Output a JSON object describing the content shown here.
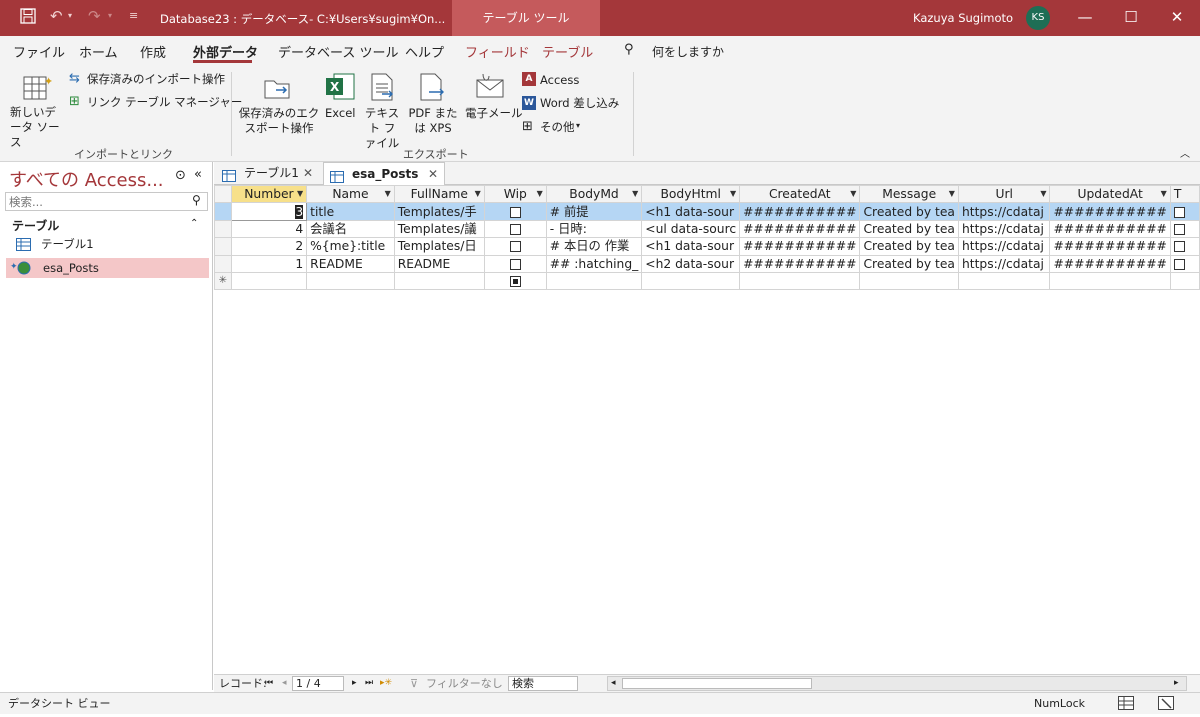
{
  "titlebar": {
    "doc_title": "Database23 : データベース- C:¥Users¥sugim¥On...",
    "tool_tab": "テーブル ツール",
    "user_name": "Kazuya Sugimoto",
    "user_initials": "KS"
  },
  "ribbon_tabs": [
    "ファイル",
    "ホーム",
    "作成",
    "外部データ",
    "データベース ツール",
    "ヘルプ",
    "フィールド",
    "テーブル"
  ],
  "tell_me": "何をしますか",
  "ribbon": {
    "new_source": "新しいデータ ソース",
    "saved_import": "保存済みのインポート操作",
    "linked_table_mgr": "リンク テーブル マネージャー",
    "group_import": "インポートとリンク",
    "saved_export": "保存済みのエクスポート操作",
    "excel": "Excel",
    "text_file": "テキスト ファイル",
    "pdf_xps": "PDF または XPS",
    "email": "電子メール",
    "access": "Access",
    "word_merge": "Word 差し込み",
    "more": "その他",
    "group_export": "エクスポート"
  },
  "nav": {
    "title": "すべての Access...",
    "search_placeholder": "検索...",
    "section": "テーブル",
    "items": [
      "テーブル1",
      "esa_Posts"
    ]
  },
  "doc_tabs": [
    "テーブル1",
    "esa_Posts"
  ],
  "table": {
    "columns": [
      "Number",
      "Name",
      "FullName",
      "Wip",
      "BodyMd",
      "BodyHtml",
      "CreatedAt",
      "Message",
      "Url",
      "UpdatedAt",
      "T"
    ],
    "rows": [
      {
        "Number": "3",
        "Name": "title",
        "FullName": "Templates/手",
        "Wip": false,
        "BodyMd": "# 前提",
        "BodyHtml": "<h1 data-sour",
        "CreatedAt": "###########",
        "Message": "Created by tea",
        "Url": "https://cdataj",
        "UpdatedAt": "###########"
      },
      {
        "Number": "4",
        "Name": "会議名",
        "FullName": "Templates/議",
        "Wip": false,
        "BodyMd": "- 日時:",
        "BodyHtml": "<ul data-sourc",
        "CreatedAt": "###########",
        "Message": "Created by tea",
        "Url": "https://cdataj",
        "UpdatedAt": "###########"
      },
      {
        "Number": "2",
        "Name": "%{me}:title",
        "FullName": "Templates/日",
        "Wip": false,
        "BodyMd": "# 本日の 作業",
        "BodyHtml": "<h1 data-sour",
        "CreatedAt": "###########",
        "Message": "Created by tea",
        "Url": "https://cdataj",
        "UpdatedAt": "###########"
      },
      {
        "Number": "1",
        "Name": "README",
        "FullName": "README",
        "Wip": false,
        "BodyMd": "##  :hatching_",
        "BodyHtml": "<h2 data-sour",
        "CreatedAt": "###########",
        "Message": "Created by tea",
        "Url": "https://cdataj",
        "UpdatedAt": "###########"
      }
    ]
  },
  "record_nav": {
    "label": "レコード:",
    "position": "1 / 4",
    "filter": "フィルターなし",
    "search": "検索"
  },
  "status": {
    "view": "データシート ビュー",
    "numlock": "NumLock"
  },
  "colors": {
    "accent": "#a4373a",
    "selected_row": "#b5d6f4",
    "selected_col": "#f7e08a"
  }
}
